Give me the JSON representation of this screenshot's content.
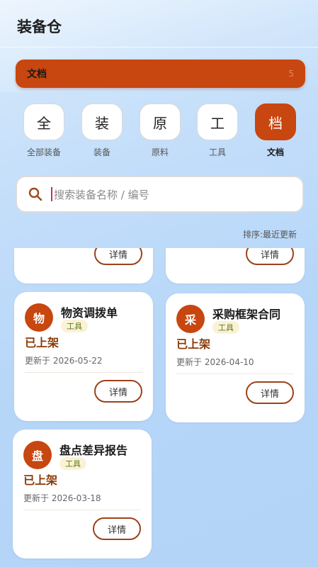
{
  "app": {
    "title": "装备仓"
  },
  "section": {
    "label": "文档",
    "count": "5"
  },
  "categories": [
    {
      "glyph": "全",
      "name": "全部装备"
    },
    {
      "glyph": "装",
      "name": "装备"
    },
    {
      "glyph": "原",
      "name": "原料"
    },
    {
      "glyph": "工",
      "name": "工具"
    },
    {
      "glyph": "档",
      "name": "文档"
    }
  ],
  "active_category": "文档",
  "search": {
    "value": "",
    "placeholder": "搜索装备名称 / 编号"
  },
  "sort": {
    "label": "排序:最近更新"
  },
  "cards": [
    {
      "detail_label": "详情"
    },
    {
      "detail_label": "详情"
    },
    {
      "avatar": "物",
      "title": "物资调拨单",
      "tag": "工具",
      "status": "已上架",
      "updated": "更新于 2026-05-22",
      "detail_label": "详情"
    },
    {
      "avatar": "采",
      "title": "采购框架合同",
      "tag": "工具",
      "status": "已上架",
      "updated": "更新于 2026-04-10",
      "detail_label": "详情"
    },
    {
      "avatar": "盘",
      "title": "盘点差异报告",
      "tag": "工具",
      "status": "已上架",
      "updated": "更新于 2026-03-18",
      "detail_label": "详情"
    }
  ],
  "colors": {
    "accent": "#c8460f",
    "status": "#8a3a06",
    "tag_bg": "#fbf2d6",
    "tag_text": "#5a7a1a"
  }
}
